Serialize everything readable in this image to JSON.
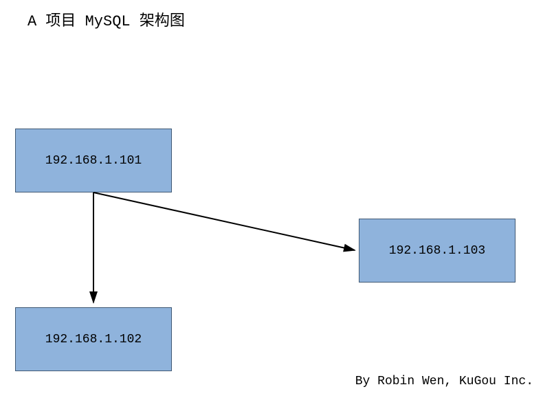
{
  "title": "A 项目 MySQL 架构图",
  "nodes": {
    "node1": "192.168.1.101",
    "node2": "192.168.1.102",
    "node3": "192.168.1.103"
  },
  "footer": "By Robin Wen, KuGou Inc.",
  "colors": {
    "nodeFill": "#8fb3dc",
    "nodeBorder": "#3f5873",
    "arrow": "#000000"
  }
}
